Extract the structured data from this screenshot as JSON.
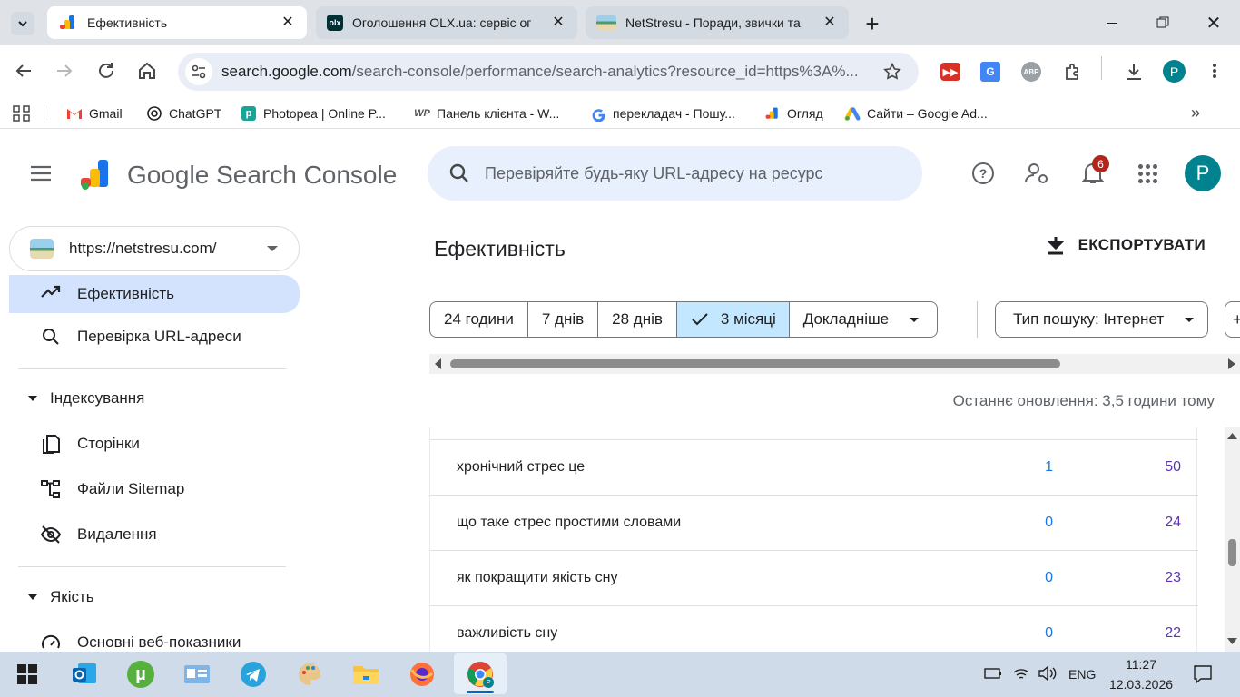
{
  "browser": {
    "tabs": [
      {
        "title": "Ефективність",
        "favicon": "search-console-icon",
        "active": true
      },
      {
        "title": "Оголошення OLX.ua: сервіс ог",
        "favicon": "olx-icon",
        "active": false
      },
      {
        "title": "NetStresu - Поради, звички та",
        "favicon": "netstresu-icon",
        "active": false
      }
    ],
    "url_host": "search.google.com",
    "url_path": "/search-console/performance/search-analytics?resource_id=https%3A%...",
    "bookmarks": [
      {
        "label": "Gmail",
        "icon": "gmail-icon"
      },
      {
        "label": "ChatGPT",
        "icon": "chatgpt-icon"
      },
      {
        "label": "Photopea | Online P...",
        "icon": "photopea-icon"
      },
      {
        "label": "Панель клієнта - W...",
        "icon": "wp-icon"
      },
      {
        "label": "перекладач - Пошу...",
        "icon": "google-icon"
      },
      {
        "label": "Огляд",
        "icon": "search-console-icon"
      },
      {
        "label": "Сайти – Google Ad...",
        "icon": "google-ads-icon"
      }
    ],
    "profile_letter": "P"
  },
  "header": {
    "product_name": "Google Search Console",
    "search_placeholder": "Перевіряйте будь-яку URL-адресу на ресурс",
    "notification_count": "6",
    "avatar_letter": "P"
  },
  "sidebar": {
    "property": "https://netstresu.com/",
    "items": [
      {
        "label": "Ефективність",
        "icon": "trending-up-icon",
        "selected": true
      },
      {
        "label": "Перевірка URL-адреси",
        "icon": "search-icon",
        "selected": false
      }
    ],
    "sections": [
      {
        "title": "Індексування",
        "items": [
          {
            "label": "Сторінки",
            "icon": "pages-icon"
          },
          {
            "label": "Файли Sitemap",
            "icon": "sitemap-icon"
          },
          {
            "label": "Видалення",
            "icon": "visibility-off-icon"
          }
        ]
      },
      {
        "title": "Якість",
        "items": [
          {
            "label": "Основні веб-показники",
            "icon": "speed-icon"
          }
        ]
      }
    ]
  },
  "main": {
    "title": "Ефективність",
    "export_label": "ЕКСПОРТУВАТИ",
    "date_ranges": [
      "24 години",
      "7 днів",
      "28 днів",
      "3 місяці",
      "Докладніше"
    ],
    "selected_range": "3 місяці",
    "search_type_label": "Тип пошуку: Інтернет",
    "last_updated": "Останнє оновлення: 3,5 години тому",
    "rows": [
      {
        "query": "хронічний стрес це",
        "clicks": "1",
        "impressions": "50"
      },
      {
        "query": "що таке стрес простими словами",
        "clicks": "0",
        "impressions": "24"
      },
      {
        "query": "як покращити якість сну",
        "clicks": "0",
        "impressions": "23"
      },
      {
        "query": "важливість сну",
        "clicks": "0",
        "impressions": "22"
      }
    ]
  },
  "taskbar": {
    "language": "ENG",
    "time": "11:27",
    "date": "12.03.2026"
  },
  "colors": {
    "accent": "#1a73e8",
    "selected_bg": "#c2e7ff",
    "nav_selected": "#d3e3fd",
    "clicks": "#1a73e8",
    "impressions": "#5e35b1"
  }
}
